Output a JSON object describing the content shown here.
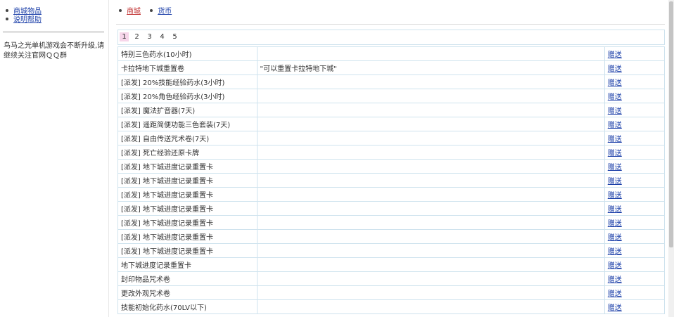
{
  "sidebar": {
    "items": [
      {
        "label": "商城物品"
      },
      {
        "label": "说明帮助"
      }
    ],
    "notice": "鸟马之光单机游戏会不断升级,请继续关注官网ＱＱ群"
  },
  "tabs": [
    {
      "label": "商城",
      "active": true
    },
    {
      "label": "货币",
      "active": false
    }
  ],
  "pagination": {
    "pages": [
      "1",
      "2",
      "3",
      "4",
      "5"
    ],
    "current": "1"
  },
  "table": {
    "action_label": "赠送",
    "rows": [
      {
        "name": "特别三色药水(10小时)",
        "desc": ""
      },
      {
        "name": "卡拉特地下城重置卷",
        "desc": "\"可以重置卡拉特地下城\""
      },
      {
        "name": "[派发] 20%技能经验药水(3小时)",
        "desc": ""
      },
      {
        "name": "[派发] 20%角色经验药水(3小时)",
        "desc": ""
      },
      {
        "name": "[派发] 魔法扩音器(7天)",
        "desc": ""
      },
      {
        "name": "[派发] 遥距简便功能三色套装(7天)",
        "desc": ""
      },
      {
        "name": "[派发] 自由传送咒术卷(7天)",
        "desc": ""
      },
      {
        "name": "[派发] 死亡经验还原卡牌",
        "desc": ""
      },
      {
        "name": "[派发] 地下城进度记录重置卡",
        "desc": ""
      },
      {
        "name": "[派发] 地下城进度记录重置卡",
        "desc": ""
      },
      {
        "name": "[派发] 地下城进度记录重置卡",
        "desc": ""
      },
      {
        "name": "[派发] 地下城进度记录重置卡",
        "desc": ""
      },
      {
        "name": "[派发] 地下城进度记录重置卡",
        "desc": ""
      },
      {
        "name": "[派发] 地下城进度记录重置卡",
        "desc": ""
      },
      {
        "name": "[派发] 地下城进度记录重置卡",
        "desc": ""
      },
      {
        "name": "地下城进度记录重置卡",
        "desc": ""
      },
      {
        "name": "封印物品咒术卷",
        "desc": ""
      },
      {
        "name": "更改外观咒术卷",
        "desc": ""
      },
      {
        "name": "技能初始化药水(70LV以下)",
        "desc": ""
      }
    ]
  },
  "colors": {
    "link": "#1a3ea8",
    "active_tab": "#c03030",
    "active_page_bg": "#f7d6ea",
    "table_border": "#cfe3ee"
  }
}
